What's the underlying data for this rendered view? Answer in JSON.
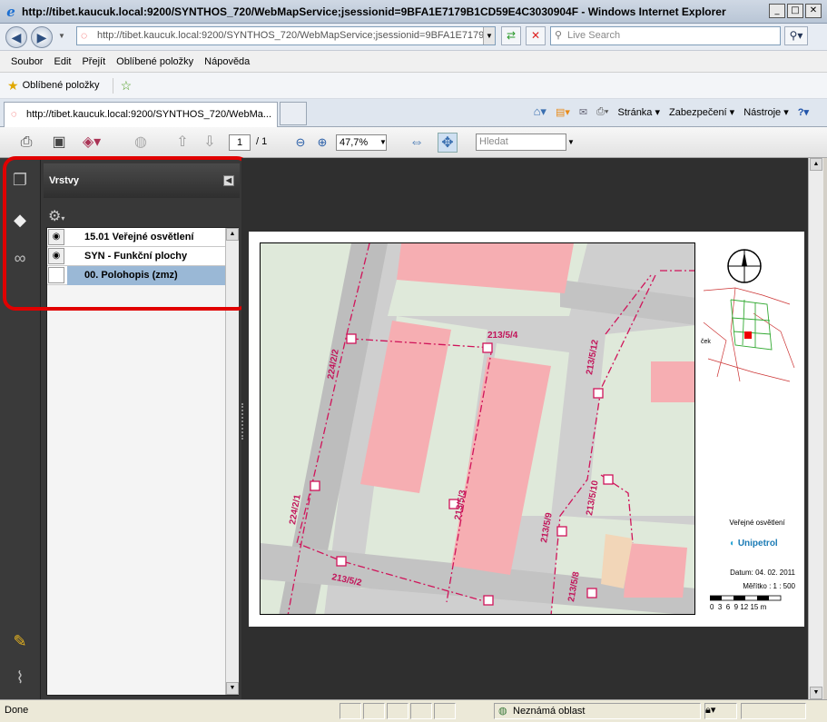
{
  "window": {
    "title": "http://tibet.kaucuk.local:9200/SYNTHOS_720/WebMapService;jsessionid=9BFA1E7179B1CD59E4C3030904F - Windows Internet Explorer"
  },
  "address": {
    "url": "http://tibet.kaucuk.local:9200/SYNTHOS_720/WebMapService;jsessionid=9BFA1E7179E",
    "search_placeholder": "Live Search"
  },
  "menu": [
    "Soubor",
    "Edit",
    "Přejít",
    "Oblíbené položky",
    "Nápověda"
  ],
  "favorites": {
    "label": "Oblíbené položky"
  },
  "tabs": {
    "active": "http://tibet.kaucuk.local:9200/SYNTHOS_720/WebMa..."
  },
  "commandbar": {
    "page": "Stránka",
    "security": "Zabezpečení",
    "tools": "Nástroje"
  },
  "viewer": {
    "page_current": "1",
    "page_total": "/ 1",
    "zoom": "47,7%",
    "find_placeholder": "Hledat"
  },
  "layers": {
    "title": "Vrstvy",
    "items": [
      {
        "label": "15.01 Veřejné osvětlení",
        "visible": true,
        "selected": false
      },
      {
        "label": "SYN - Funkční plochy",
        "visible": true,
        "selected": false
      },
      {
        "label": "00. Polohopis (zmz)",
        "visible": false,
        "selected": true
      }
    ]
  },
  "map": {
    "parcels": [
      "213/5/4",
      "224/2/2",
      "213/5/12",
      "213/5/3",
      "224/2/1",
      "213/5/2",
      "213/5/9",
      "213/5/10",
      "213/5/8"
    ],
    "overview_label": "ček",
    "legend_title": "Veřejné osvětlení",
    "brand": "Unipetrol",
    "date": "Datum: 04. 02. 2011",
    "scale": "Měřítko : 1 : 500",
    "scalebar": "0  3  6  9 12 15 m"
  },
  "status": {
    "text": "Done",
    "zone": "Neznámá oblast"
  },
  "colors": {
    "highlight": "#e10000",
    "parcel_line": "#d0145a",
    "building": "#f6aeb2",
    "green": "#dde9d6"
  }
}
